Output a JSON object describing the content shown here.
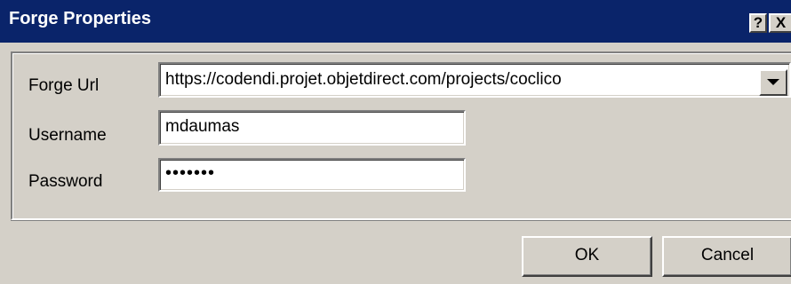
{
  "window": {
    "title": "Forge Properties",
    "help_label": "?",
    "close_label": "X"
  },
  "form": {
    "forge_url": {
      "label": "Forge Url",
      "value": "https://codendi.projet.objetdirect.com/projects/coclico"
    },
    "username": {
      "label": "Username",
      "value": "mdaumas"
    },
    "password": {
      "label": "Password",
      "value": "•••••••"
    }
  },
  "buttons": {
    "ok_label": "OK",
    "cancel_label": "Cancel"
  },
  "colors": {
    "titlebar": "#0a246a",
    "dialog_background": "#d4d0c8"
  },
  "icons": {
    "help": "help-icon",
    "close": "close-icon",
    "dropdown": "chevron-down-icon"
  }
}
